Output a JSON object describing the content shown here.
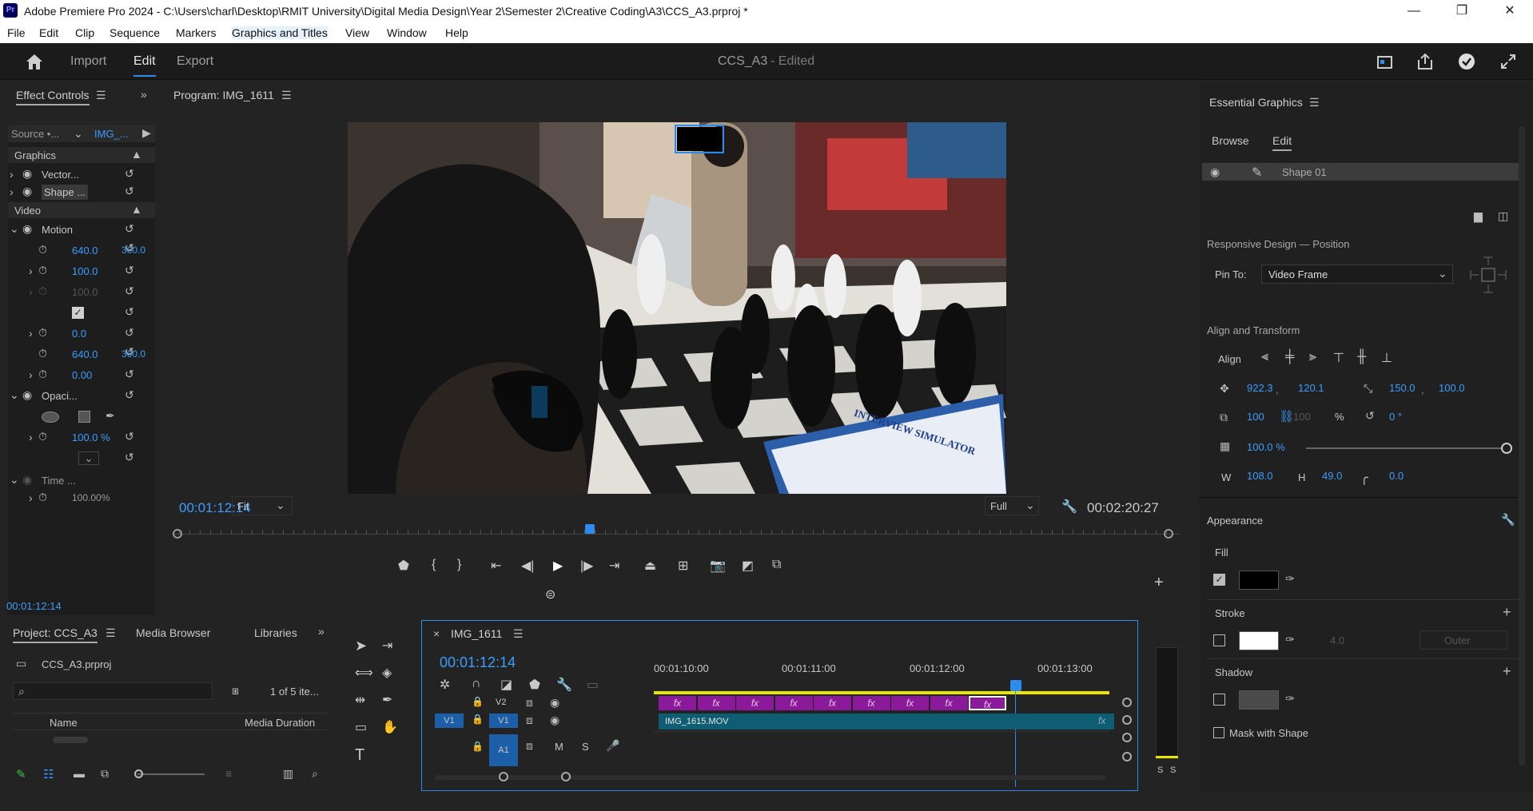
{
  "window": {
    "app_icon": "Pr",
    "title": "Adobe Premiere Pro 2024 - C:\\Users\\charl\\Desktop\\RMIT University\\Digital Media Design\\Year 2\\Semester 2\\Creative Coding\\A3\\CCS_A3.prproj *",
    "min": "—",
    "max": "❐",
    "close": "✕"
  },
  "menu": [
    "File",
    "Edit",
    "Clip",
    "Sequence",
    "Markers",
    "Graphics and Titles",
    "View",
    "Window",
    "Help"
  ],
  "appbar": {
    "tabs": [
      "Import",
      "Edit",
      "Export"
    ],
    "active": "Edit",
    "project": "CCS_A3",
    "status": "- Edited"
  },
  "effect_controls": {
    "title": "Effect Controls",
    "source": "Source •...",
    "clip": "IMG_...",
    "graphics_label": "Graphics",
    "vector": "Vector...",
    "shape": "Shape ...",
    "video_label": "Video",
    "motion": "Motion",
    "values": [
      "640.0",
      "360.0",
      "100.0",
      "100.0",
      "0.0",
      "640.0",
      "360.0",
      "0.00"
    ],
    "opacity": "Opaci...",
    "opacity_value": "100.0 %",
    "time": "Time ...",
    "time_value": "100.00%",
    "timecode": "00:01:12:14"
  },
  "program": {
    "title": "Program: IMG_1611",
    "timecode": "00:01:12:14",
    "fit": "Fit",
    "quality": "Full",
    "duration": "00:02:20:27",
    "laptop_text": "INTERVIEW SIMULATOR"
  },
  "essential": {
    "title": "Essential Graphics",
    "tabs": [
      "Browse",
      "Edit"
    ],
    "layer": "Shape 01",
    "responsive": "Responsive Design — Position",
    "pin_label": "Pin To:",
    "pin_value": "Video Frame",
    "align_transform": "Align and Transform",
    "align": "Align",
    "pos_x": "922.3",
    "pos_y": "120.1",
    "anchor_x": "150.0",
    "anchor_y": "100.0",
    "scale": "100",
    "scale_h": "100",
    "pct": "%",
    "rotation": "0 °",
    "opacity": "100.0 %",
    "w_label": "W",
    "w": "108.0",
    "h_label": "H",
    "h": "49.0",
    "corner": "0.0",
    "appearance": "Appearance",
    "fill": "Fill",
    "stroke": "Stroke",
    "stroke_width": "4.0",
    "stroke_type": "Outer",
    "shadow": "Shadow",
    "mask": "Mask with Shape",
    "colors": {
      "fill": "#000000",
      "stroke": "#ffffff",
      "shadow": "#4a4a4a"
    }
  },
  "project": {
    "tabs": [
      "Project: CCS_A3",
      "Media Browser",
      "Libraries"
    ],
    "file": "CCS_A3.prproj",
    "count": "1 of 5 ite...",
    "col_name": "Name",
    "col_duration": "Media Duration"
  },
  "timeline": {
    "sequence": "IMG_1611",
    "timecode": "00:01:12:14",
    "ruler": [
      "00:01:10:00",
      "00:01:11:00",
      "00:01:12:00",
      "00:01:13:00"
    ],
    "tracks": {
      "v2": "V2",
      "v1": "V1",
      "src_v1": "V1",
      "a1": "A1",
      "m": "M",
      "s": "S"
    },
    "clip_v1": "IMG_1615.MOV",
    "fx": "fx",
    "meter": [
      "S",
      "S"
    ]
  }
}
